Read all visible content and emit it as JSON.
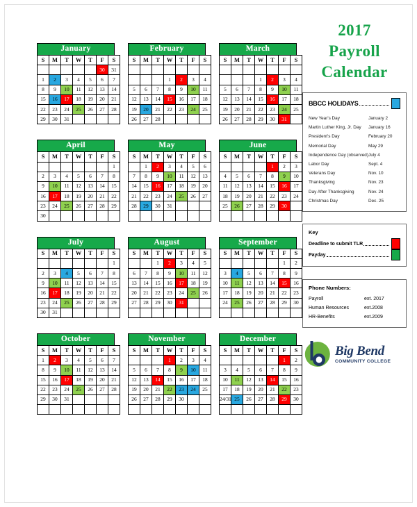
{
  "title": {
    "line1": "2017",
    "line2": "Payroll",
    "line3": "Calendar"
  },
  "colors": {
    "header_green": "#17a94a",
    "payday_green": "#8fd14f",
    "deadline_red": "#ff0000",
    "holiday_blue": "#29a8e0",
    "title_green": "#16a34a",
    "logo_navy": "#1f3864"
  },
  "weekday_headers": [
    "S",
    "M",
    "T",
    "W",
    "T",
    "F",
    "S"
  ],
  "months": [
    {
      "name": "January",
      "weeks": [
        [
          "",
          "",
          "",
          "",
          "",
          "30",
          "31"
        ],
        [
          "1",
          "2",
          "3",
          "4",
          "5",
          "6",
          "7"
        ],
        [
          "8",
          "9",
          "10",
          "11",
          "12",
          "13",
          "14"
        ],
        [
          "15",
          "16",
          "17",
          "18",
          "19",
          "20",
          "21"
        ],
        [
          "22",
          "23",
          "24",
          "25",
          "26",
          "27",
          "28"
        ],
        [
          "29",
          "30",
          "31",
          "",
          "",
          "",
          ""
        ]
      ],
      "red": [
        "30"
      ],
      "green": [
        "10",
        "25"
      ],
      "blue": [
        "2",
        "16"
      ],
      "red_cells": [
        "0-5",
        "3-2"
      ],
      "green_cells": [
        "2-2",
        "4-3"
      ],
      "blue_cells": [
        "1-1",
        "3-1"
      ]
    },
    {
      "name": "February",
      "weeks": [
        [
          "",
          "",
          "",
          "",
          "",
          "",
          ""
        ],
        [
          "",
          "",
          "",
          "1",
          "2",
          "3",
          "4"
        ],
        [
          "5",
          "6",
          "7",
          "8",
          "9",
          "10",
          "11"
        ],
        [
          "12",
          "13",
          "14",
          "15",
          "16",
          "17",
          "18"
        ],
        [
          "19",
          "20",
          "21",
          "22",
          "23",
          "24",
          "25"
        ],
        [
          "26",
          "27",
          "28",
          "",
          "",
          "",
          ""
        ]
      ],
      "red_cells": [
        "1-4",
        "3-3"
      ],
      "green_cells": [
        "2-5",
        "4-5"
      ],
      "blue_cells": [
        "4-1"
      ]
    },
    {
      "name": "March",
      "weeks": [
        [
          "",
          "",
          "",
          "",
          "",
          "",
          ""
        ],
        [
          "",
          "",
          "",
          "1",
          "2",
          "3",
          "4"
        ],
        [
          "5",
          "6",
          "7",
          "8",
          "9",
          "10",
          "11"
        ],
        [
          "12",
          "13",
          "14",
          "15",
          "16",
          "17",
          "18"
        ],
        [
          "19",
          "20",
          "21",
          "22",
          "23",
          "24",
          "25"
        ],
        [
          "26",
          "27",
          "28",
          "29",
          "30",
          "31",
          ""
        ]
      ],
      "red_cells": [
        "1-4",
        "3-4",
        "5-5"
      ],
      "green_cells": [
        "2-5",
        "4-5"
      ],
      "blue_cells": []
    },
    {
      "name": "April",
      "weeks": [
        [
          "",
          "",
          "",
          "",
          "",
          "",
          "1"
        ],
        [
          "2",
          "3",
          "4",
          "5",
          "6",
          "7",
          "8"
        ],
        [
          "9",
          "10",
          "11",
          "12",
          "13",
          "14",
          "15"
        ],
        [
          "16",
          "17",
          "18",
          "19",
          "20",
          "21",
          "22"
        ],
        [
          "23",
          "24",
          "25",
          "26",
          "27",
          "28",
          "29"
        ],
        [
          "30",
          "",
          "",
          "",
          "",
          "",
          ""
        ]
      ],
      "red_cells": [
        "3-1"
      ],
      "green_cells": [
        "2-1",
        "4-2"
      ],
      "blue_cells": []
    },
    {
      "name": "May",
      "weeks": [
        [
          "",
          "1",
          "2",
          "3",
          "4",
          "5",
          "6"
        ],
        [
          "7",
          "8",
          "9",
          "10",
          "11",
          "12",
          "13"
        ],
        [
          "14",
          "15",
          "16",
          "17",
          "18",
          "19",
          "20"
        ],
        [
          "21",
          "22",
          "23",
          "24",
          "25",
          "26",
          "27"
        ],
        [
          "28",
          "29",
          "30",
          "31",
          "",
          "",
          ""
        ],
        [
          "",
          "",
          "",
          "",
          "",
          "",
          ""
        ]
      ],
      "red_cells": [
        "0-2",
        "2-2"
      ],
      "green_cells": [
        "1-3",
        "3-4"
      ],
      "blue_cells": [
        "4-1"
      ]
    },
    {
      "name": "June",
      "weeks": [
        [
          "",
          "",
          "",
          "",
          "1",
          "2",
          "3"
        ],
        [
          "4",
          "5",
          "6",
          "7",
          "8",
          "9",
          "10"
        ],
        [
          "11",
          "12",
          "13",
          "14",
          "15",
          "16",
          "17"
        ],
        [
          "18",
          "19",
          "20",
          "21",
          "22",
          "23",
          "24"
        ],
        [
          "25",
          "26",
          "27",
          "28",
          "29",
          "30",
          ""
        ],
        [
          "",
          "",
          "",
          "",
          "",
          "",
          ""
        ]
      ],
      "red_cells": [
        "0-4",
        "2-5",
        "4-5"
      ],
      "green_cells": [
        "1-5",
        "4-1"
      ],
      "blue_cells": []
    },
    {
      "name": "July",
      "weeks": [
        [
          "",
          "",
          "",
          "",
          "",
          "",
          "1"
        ],
        [
          "2",
          "3",
          "4",
          "5",
          "6",
          "7",
          "8"
        ],
        [
          "9",
          "10",
          "11",
          "12",
          "13",
          "14",
          "15"
        ],
        [
          "16",
          "17",
          "18",
          "19",
          "20",
          "21",
          "22"
        ],
        [
          "23",
          "24",
          "25",
          "26",
          "27",
          "28",
          "29"
        ],
        [
          "30",
          "31",
          "",
          "",
          "",
          "",
          ""
        ]
      ],
      "red_cells": [
        "3-1"
      ],
      "green_cells": [
        "2-1",
        "4-2"
      ],
      "blue_cells": [
        "1-2"
      ]
    },
    {
      "name": "August",
      "weeks": [
        [
          "",
          "",
          "1",
          "2",
          "3",
          "4",
          "5"
        ],
        [
          "6",
          "7",
          "8",
          "9",
          "10",
          "11",
          "12"
        ],
        [
          "13",
          "14",
          "15",
          "16",
          "17",
          "18",
          "19"
        ],
        [
          "20",
          "21",
          "22",
          "23",
          "24",
          "25",
          "26"
        ],
        [
          "27",
          "28",
          "29",
          "30",
          "31",
          "",
          ""
        ],
        [
          "",
          "",
          "",
          "",
          "",
          "",
          ""
        ]
      ],
      "red_cells": [
        "0-3",
        "2-4",
        "4-4"
      ],
      "green_cells": [
        "1-4",
        "3-5"
      ],
      "blue_cells": []
    },
    {
      "name": "September",
      "weeks": [
        [
          "",
          "",
          "",
          "",
          "",
          "1",
          "2"
        ],
        [
          "3",
          "4",
          "5",
          "6",
          "7",
          "8",
          "9"
        ],
        [
          "10",
          "11",
          "12",
          "13",
          "14",
          "15",
          "16"
        ],
        [
          "17",
          "18",
          "19",
          "20",
          "21",
          "22",
          "23"
        ],
        [
          "24",
          "25",
          "26",
          "27",
          "28",
          "29",
          "30"
        ],
        [
          "",
          "",
          "",
          "",
          "",
          "",
          ""
        ]
      ],
      "red_cells": [
        "2-5"
      ],
      "green_cells": [
        "2-1",
        "4-1"
      ],
      "blue_cells": [
        "1-1"
      ]
    },
    {
      "name": "October",
      "weeks": [
        [
          "1",
          "2",
          "3",
          "4",
          "5",
          "6",
          "7"
        ],
        [
          "8",
          "9",
          "10",
          "11",
          "12",
          "13",
          "14"
        ],
        [
          "15",
          "16",
          "17",
          "18",
          "19",
          "20",
          "21"
        ],
        [
          "22",
          "23",
          "24",
          "25",
          "26",
          "27",
          "28"
        ],
        [
          "29",
          "30",
          "31",
          "",
          "",
          "",
          ""
        ],
        [
          "",
          "",
          "",
          "",
          "",
          "",
          ""
        ]
      ],
      "red_cells": [
        "0-1",
        "2-2"
      ],
      "green_cells": [
        "1-2",
        "3-3"
      ],
      "blue_cells": []
    },
    {
      "name": "November",
      "weeks": [
        [
          "",
          "",
          "",
          "1",
          "2",
          "3",
          "4"
        ],
        [
          "5",
          "6",
          "7",
          "8",
          "9",
          "10",
          "11"
        ],
        [
          "12",
          "13",
          "14",
          "15",
          "16",
          "17",
          "18"
        ],
        [
          "19",
          "20",
          "21",
          "22",
          "23",
          "24",
          "25"
        ],
        [
          "26",
          "27",
          "28",
          "29",
          "30",
          "",
          ""
        ],
        [
          "",
          "",
          "",
          "",
          "",
          "",
          ""
        ]
      ],
      "red_cells": [
        "0-3",
        "2-2"
      ],
      "green_cells": [
        "1-4",
        "3-3"
      ],
      "blue_cells": [
        "1-5",
        "3-4",
        "3-5"
      ]
    },
    {
      "name": "December",
      "weeks": [
        [
          "",
          "",
          "",
          "",
          "",
          "1",
          "2"
        ],
        [
          "3",
          "4",
          "5",
          "6",
          "7",
          "8",
          "9"
        ],
        [
          "10",
          "11",
          "12",
          "13",
          "14",
          "15",
          "16"
        ],
        [
          "17",
          "18",
          "19",
          "20",
          "21",
          "22",
          "23"
        ],
        [
          "24/31",
          "25",
          "26",
          "27",
          "28",
          "29",
          "30"
        ],
        [
          "",
          "",
          "",
          "",
          "",
          "",
          ""
        ]
      ],
      "red_cells": [
        "0-5",
        "2-4",
        "4-5"
      ],
      "green_cells": [
        "2-1",
        "3-5"
      ],
      "blue_cells": [
        "4-1"
      ],
      "small_cells": [
        "4-0"
      ]
    }
  ],
  "holidays": {
    "heading": "BBCC HOLIDAYS",
    "swatch": "holiday-blue",
    "items": [
      {
        "name": "New Year's Day",
        "date": "January 2"
      },
      {
        "name": "Martin Luther King, Jr. Day",
        "date": "January 16"
      },
      {
        "name": "President's Day",
        "date": "February 20"
      },
      {
        "name": "Memorial Day",
        "date": "May 29"
      },
      {
        "name": "Independence Day (observed)",
        "date": "July 4"
      },
      {
        "name": "Labor Day",
        "date": "Sept. 4"
      },
      {
        "name": "Veterans Day",
        "date": "Nov. 10"
      },
      {
        "name": "Thanksgiving",
        "date": "Nov. 23"
      },
      {
        "name": "Day After Thanksgiving",
        "date": "Nov. 24"
      },
      {
        "name": "Christmas Day",
        "date": "Dec. 25"
      }
    ]
  },
  "key": {
    "heading": "Key",
    "items": [
      {
        "label": "Deadline to submit TLR",
        "color": "red"
      },
      {
        "label": "Payday",
        "color": "green"
      }
    ]
  },
  "phones": {
    "heading": "Phone Numbers:",
    "items": [
      {
        "name": "Payroll",
        "ext": "ext. 2017"
      },
      {
        "name": "Human Resources",
        "ext": "ext.2008"
      },
      {
        "name": "HR-Benefits",
        "ext": "ext.2009"
      }
    ]
  },
  "logo": {
    "name": "Big Bend",
    "tagline": "COMMUNITY COLLEGE"
  }
}
